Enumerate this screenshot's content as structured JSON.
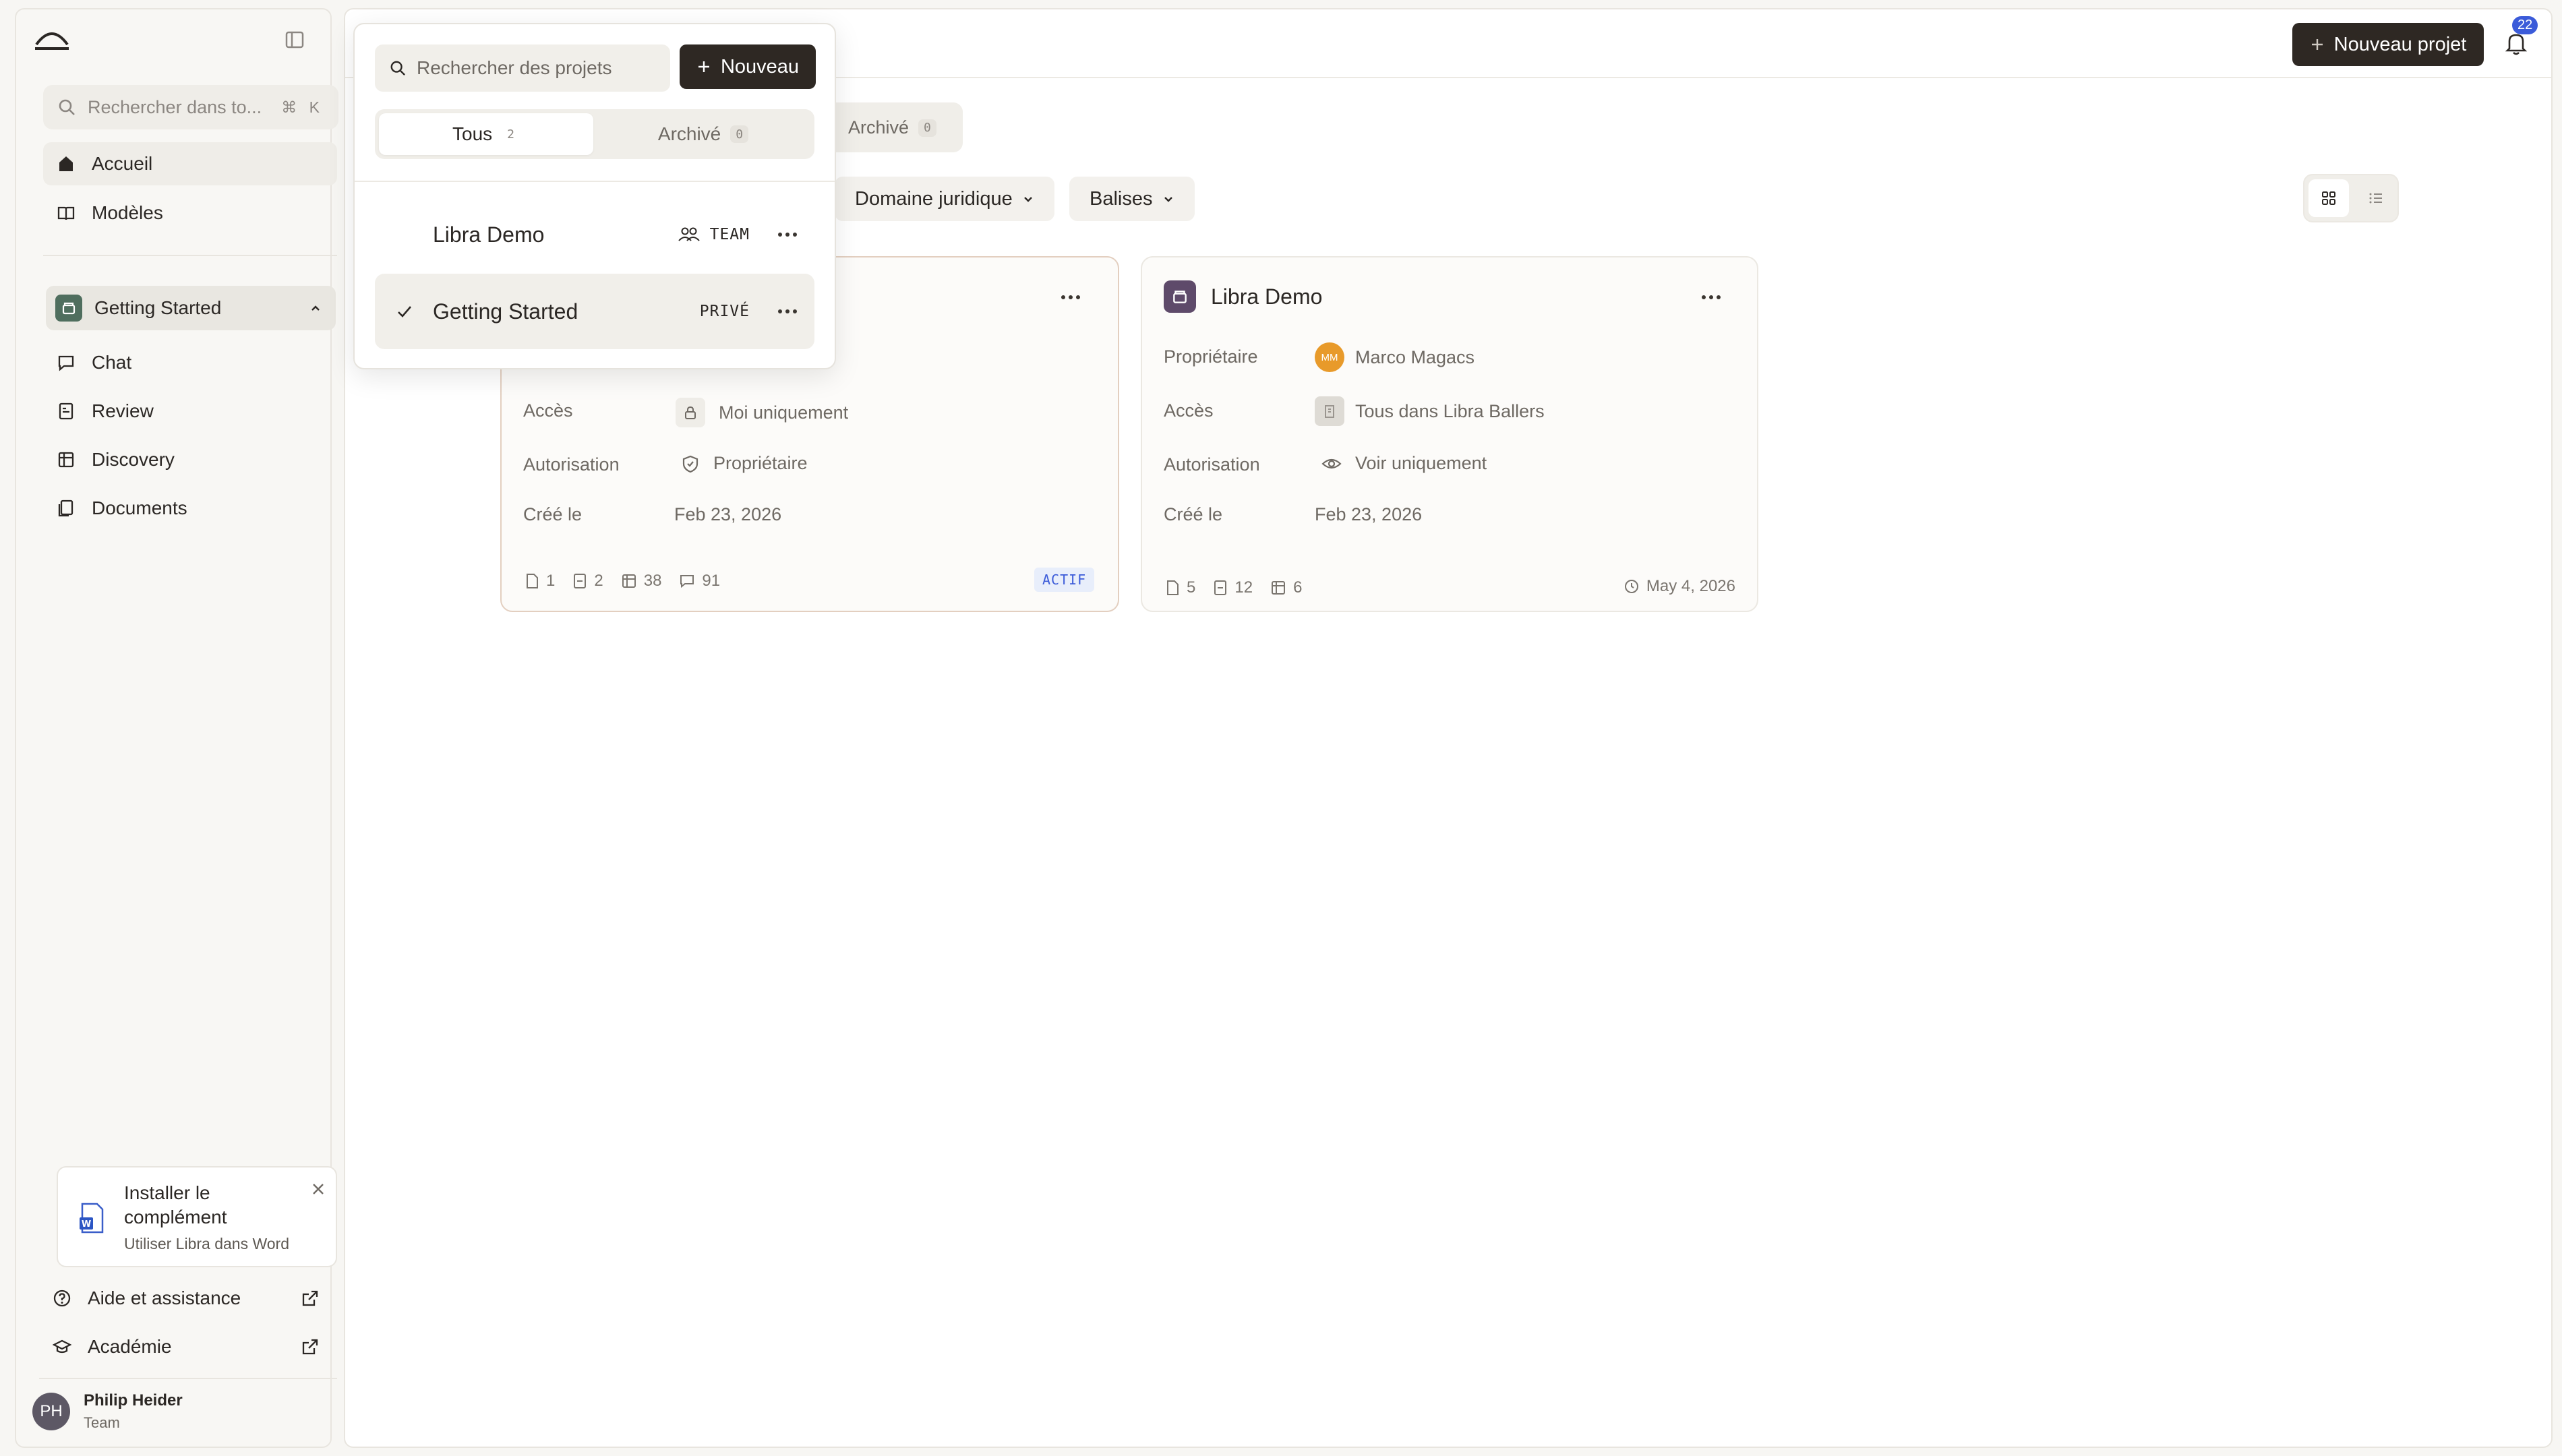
{
  "sidebar": {
    "search_placeholder": "Rechercher dans to...",
    "search_shortcut": "⌘ K",
    "nav": [
      {
        "label": "Accueil",
        "icon": "home-icon"
      },
      {
        "label": "Modèles",
        "icon": "book-icon"
      }
    ],
    "project": {
      "label": "Getting Started",
      "icon": "project-box-icon"
    },
    "project_nav": [
      {
        "label": "Chat",
        "icon": "chat-icon"
      },
      {
        "label": "Review",
        "icon": "review-icon"
      },
      {
        "label": "Discovery",
        "icon": "table-icon"
      },
      {
        "label": "Documents",
        "icon": "documents-icon"
      }
    ],
    "install": {
      "title_line1": "Installer le",
      "title_line2": "complément",
      "subtitle": "Utiliser Libra dans Word",
      "icon": "word-icon"
    },
    "footer_links": [
      {
        "label": "Aide et assistance",
        "icon": "help-icon"
      },
      {
        "label": "Académie",
        "icon": "graduation-icon"
      }
    ],
    "user": {
      "initials": "PH",
      "name": "Philip Heider",
      "role": "Team"
    }
  },
  "header": {
    "new_project_label": "Nouveau projet",
    "notifications_count": "22"
  },
  "main_tabs": {
    "archived_label": "Archivé",
    "archived_count": "0"
  },
  "filters": [
    {
      "label": "Domaine juridique"
    },
    {
      "label": "Balises"
    }
  ],
  "view_toggle": {
    "grid": "grid-view-icon",
    "list": "list-view-icon"
  },
  "cards": [
    {
      "title": "Getting Started",
      "rows": [
        {
          "label": "Accès",
          "value": "Moi uniquement",
          "icon": "lock-icon"
        },
        {
          "label": "Autorisation",
          "value": "Propriétaire",
          "icon": "shield-icon"
        },
        {
          "label": "Créé le",
          "value": "Feb 23, 2026"
        }
      ],
      "stats": [
        "1",
        "2",
        "38",
        "91"
      ],
      "status": "ACTIF"
    },
    {
      "title": "Libra Demo",
      "rows": [
        {
          "label": "Propriétaire",
          "value": "Marco Magacs",
          "avatar": "MM"
        },
        {
          "label": "Accès",
          "value": "Tous dans Libra Ballers",
          "icon": "building-icon"
        },
        {
          "label": "Autorisation",
          "value": "Voir uniquement",
          "icon": "eye-icon"
        },
        {
          "label": "Créé le",
          "value": "Feb 23, 2026"
        }
      ],
      "stats": [
        "5",
        "12",
        "6"
      ],
      "updated": "May 4, 2026"
    }
  ],
  "dropdown": {
    "search_placeholder": "Rechercher des projets",
    "new_label": "Nouveau",
    "tabs": [
      {
        "label": "Tous",
        "count": "2"
      },
      {
        "label": "Archivé",
        "count": "0"
      }
    ],
    "items": [
      {
        "name": "Libra Demo",
        "tag": "TEAM",
        "icon": "team-icon"
      },
      {
        "name": "Getting Started",
        "tag": "PRIVÉ",
        "selected": true
      }
    ]
  },
  "colors": {
    "accent_dark": "#2e2823",
    "project_green": "#4f6e5e",
    "project_purple": "#5e4a6a",
    "avatar_orange": "#e89a2a",
    "badge_blue": "#3b5bd9",
    "status_blue_bg": "#e8eefb"
  }
}
